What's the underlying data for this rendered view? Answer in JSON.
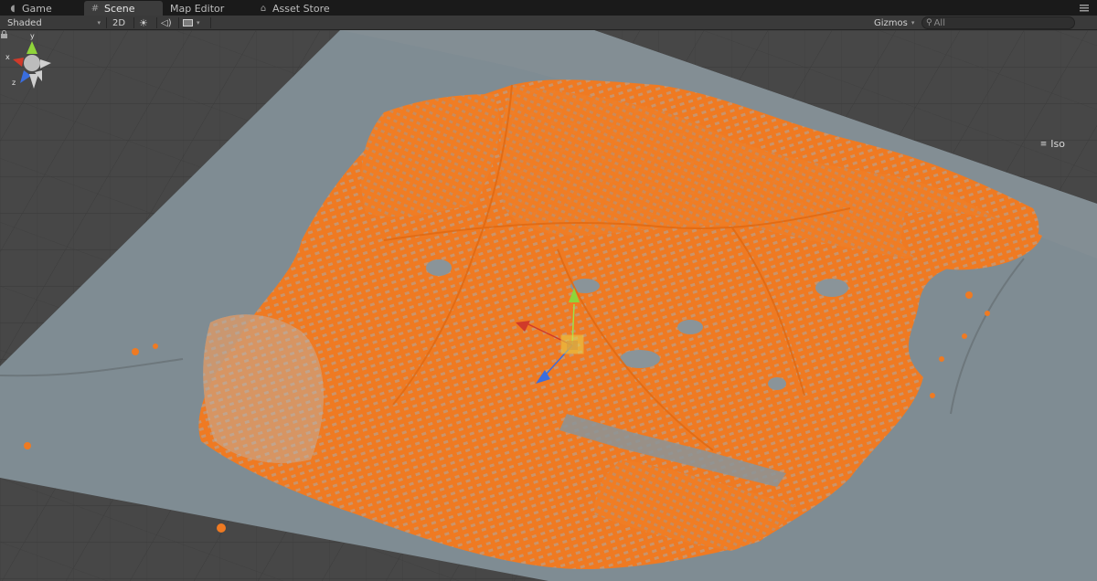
{
  "tabs": [
    {
      "label": "Game",
      "icon": "pacman-icon"
    },
    {
      "label": "Scene",
      "icon": "grid-icon"
    },
    {
      "label": "Map Editor",
      "icon": ""
    },
    {
      "label": "Asset Store",
      "icon": "lock-icon"
    }
  ],
  "toolbar": {
    "shading_mode": "Shaded",
    "mode_2d": "2D",
    "gizmos_label": "Gizmos",
    "search_value": "All"
  },
  "orientation_gizmo": {
    "x_label": "x",
    "y_label": "y",
    "z_label": "z",
    "projection_label": "Iso"
  },
  "colors": {
    "buildings": "#f07a1e",
    "ground_plane": "#7f8c93",
    "grid_background": "#474747",
    "axis_x": "#d03a2a",
    "axis_y": "#8fd43a",
    "axis_z": "#3a6ee0"
  }
}
